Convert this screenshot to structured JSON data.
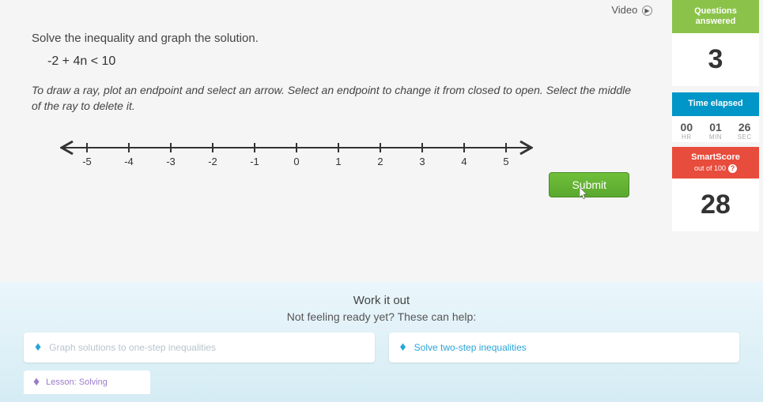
{
  "video": {
    "label": "Video"
  },
  "question": {
    "prompt": "Solve the inequality and graph the solution.",
    "inequality": "-2 + 4n < 10",
    "instructions": "To draw a ray, plot an endpoint and select an arrow. Select an endpoint to change it from closed to open. Select the middle of the ray to delete it.",
    "ticks": [
      "-5",
      "-4",
      "-3",
      "-2",
      "-1",
      "0",
      "1",
      "2",
      "3",
      "4",
      "5"
    ]
  },
  "submit": {
    "label": "Submit"
  },
  "sidebar": {
    "questions_label": "Questions answered",
    "questions_count": "3",
    "time_label": "Time elapsed",
    "time": {
      "hr": "00",
      "min": "01",
      "sec": "26",
      "hr_u": "HR",
      "min_u": "MIN",
      "sec_u": "SEC"
    },
    "smart_label": "SmartScore",
    "smart_sub": "out of 100",
    "smart_score": "28"
  },
  "workout": {
    "title": "Work it out",
    "subtitle": "Not feeling ready yet? These can help:",
    "help1": "Graph solutions to one-step inequalities",
    "help2": "Solve two-step inequalities",
    "lesson": "Lesson: Solving"
  }
}
